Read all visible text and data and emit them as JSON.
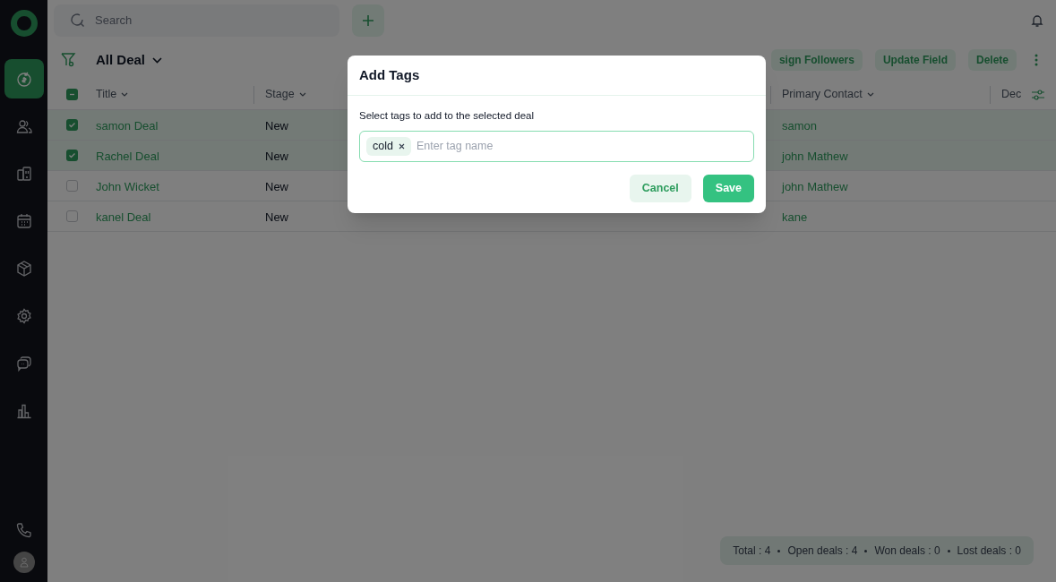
{
  "sidebar": {
    "items": [
      {
        "kind": "deals",
        "selected": true
      },
      {
        "kind": "contacts",
        "selected": false
      },
      {
        "kind": "companies",
        "selected": false
      },
      {
        "kind": "calendar",
        "selected": false
      },
      {
        "kind": "products",
        "selected": false
      },
      {
        "kind": "settings",
        "selected": false
      },
      {
        "kind": "chat",
        "selected": false
      },
      {
        "kind": "reports",
        "selected": false
      }
    ],
    "bottom": [
      {
        "kind": "phone"
      },
      {
        "kind": "avatar"
      }
    ]
  },
  "search": {
    "placeholder": "Search"
  },
  "view": {
    "title": "All Deal"
  },
  "actions": [
    "sign Followers",
    "Update Field",
    "Delete"
  ],
  "table": {
    "select_all_partial": true,
    "columns": [
      {
        "label": "Title",
        "sortable": true
      },
      {
        "label": "Stage",
        "sortable": true
      },
      {
        "label": "Primary Contact",
        "sortable": true
      },
      {
        "label": "Dec",
        "sortable": false
      }
    ],
    "rows": [
      {
        "selected": true,
        "title": "samon Deal",
        "stage": "New",
        "primary_contact": "samon"
      },
      {
        "selected": true,
        "title": "Rachel Deal",
        "stage": "New",
        "primary_contact": "john Mathew"
      },
      {
        "selected": false,
        "title": "John Wicket",
        "stage": "New",
        "primary_contact": "john Mathew"
      },
      {
        "selected": false,
        "title": "kanel Deal",
        "stage": "New",
        "primary_contact": "kane"
      }
    ]
  },
  "footer": {
    "summary": [
      "Total : 4",
      "Open deals : 4",
      "Won deals : 0",
      "Lost deals : 0"
    ]
  },
  "dialog": {
    "title": "Add Tags",
    "prompt": "Select tags to add to the selected deal",
    "tags": [
      "cold"
    ],
    "placeholder": "Enter tag name",
    "buttons": [
      {
        "label": "Cancel",
        "kind": "secondary"
      },
      {
        "label": "Save",
        "kind": "primary"
      }
    ]
  }
}
